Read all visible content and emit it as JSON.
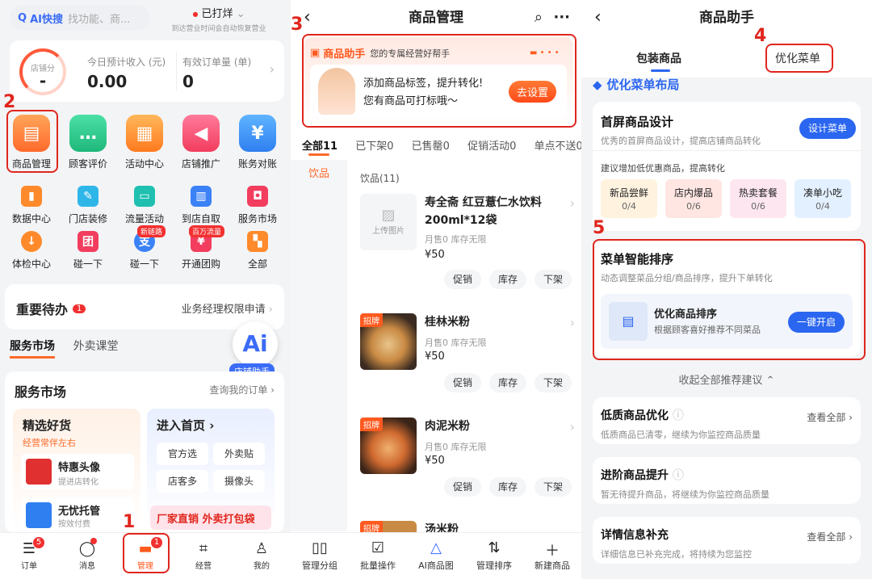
{
  "panel1": {
    "search_brand": "AI快搜",
    "search_placeholder": "找功能、商...",
    "status": "已打烊",
    "status_sub": "到达营业时间会自动恢复营业",
    "gauge_label": "店铺分",
    "gauge_value": "-",
    "income_label": "今日预计收入 (元)",
    "income_value": "0.00",
    "orders_label": "有效订单量 (单)",
    "orders_value": "0",
    "main_icons": [
      "商品管理",
      "顾客评价",
      "活动中心",
      "店铺推广",
      "账务对账"
    ],
    "row2": [
      "数据中心",
      "门店装修",
      "流量活动",
      "到店自取",
      "服务市场"
    ],
    "row3": [
      "体检中心",
      "碰一下",
      "碰一下",
      "开通团购",
      "全部"
    ],
    "row3_tags": [
      "新链路",
      "百万流量"
    ],
    "todo_title": "重要待办",
    "todo_count": "1",
    "todo_link": "业务经理权限申请",
    "tabs": [
      "服务市场",
      "外卖课堂"
    ],
    "ai_label": "店铺助手",
    "market_title": "服务市场",
    "market_link": "查询我的订单",
    "goods_title": "精选好货",
    "goods_sub": "经营常伴左右",
    "item1": "特惠头像",
    "item1_sub": "提进店转化",
    "item2": "无忧托管",
    "item2_sub": "按效付费",
    "home_title": "进入首页",
    "chips": [
      "官方选",
      "外卖贴",
      "店客多",
      "摄像头"
    ],
    "banner_text": "厂家直销 外卖打包袋",
    "tabbar": [
      "订单",
      "消息",
      "管理",
      "经营",
      "我的"
    ],
    "tabbar_badges": {
      "order": "5",
      "manage": "1"
    },
    "steps": [
      "1",
      "2"
    ]
  },
  "panel2": {
    "title": "商品管理",
    "assistant_title": "商品助手",
    "assistant_sub": "您的专属经营好帮手",
    "assistant_line1": "添加商品标签，提升转化!",
    "assistant_line2": "您有商品可打标哦～",
    "assistant_btn": "去设置",
    "tabs": [
      "全部11",
      "已下架0",
      "已售罄0",
      "促销活动0",
      "单点不送0"
    ],
    "left_cat": "饮品",
    "group_label": "饮品(11)",
    "upload_label": "上传图片",
    "products": [
      {
        "name": "寿全斋 红豆薏仁水饮料200ml*12袋",
        "meta": "月售0 库存无限",
        "price": "¥50",
        "badge": ""
      },
      {
        "name": "桂林米粉",
        "meta": "月售0 库存无限",
        "price": "¥50",
        "badge": "招牌"
      },
      {
        "name": "肉泥米粉",
        "meta": "月售0 库存无限",
        "price": "¥50",
        "badge": "招牌"
      },
      {
        "name": "汤米粉",
        "meta": "",
        "price": "",
        "badge": "招牌"
      }
    ],
    "product_btns": [
      "促销",
      "库存",
      "下架"
    ],
    "bottom": [
      "管理分组",
      "批量操作",
      "AI商品图",
      "管理排序",
      "新建商品"
    ],
    "step": "3"
  },
  "panel3": {
    "title": "商品助手",
    "tabs": [
      "包装商品",
      "优化菜单"
    ],
    "section": "优化菜单布局",
    "first_title": "首屏商品设计",
    "first_sub": "优秀的首屏商品设计，提高店铺商品转化",
    "first_btn": "设计菜单",
    "suggest": "建议增加低优惠商品，提高转化",
    "minis": [
      {
        "name": "新品尝鲜",
        "count": "0/4"
      },
      {
        "name": "店内爆品",
        "count": "0/6"
      },
      {
        "name": "热卖套餐",
        "count": "0/6"
      },
      {
        "name": "凑单小吃",
        "count": "0/4"
      }
    ],
    "smart_title": "菜单智能排序",
    "smart_sub": "动态调整菜品分组/商品排序，提升下单转化",
    "smart_item": "优化商品排序",
    "smart_item_sub": "根据顾客喜好推荐不同菜品",
    "smart_btn": "一键开启",
    "collapse": "收起全部推荐建议",
    "blocks": [
      {
        "title": "低质商品优化",
        "sub": "低质商品已清零，继续为你监控商品质量",
        "link": "查看全部"
      },
      {
        "title": "进阶商品提升",
        "sub": "暂无待提升商品，将继续为你监控商品质量",
        "link": ""
      },
      {
        "title": "详情信息补充",
        "sub": "详细信息已补充完成，将持续为您监控",
        "link": "查看全部"
      }
    ],
    "steps": [
      "4",
      "5"
    ]
  }
}
